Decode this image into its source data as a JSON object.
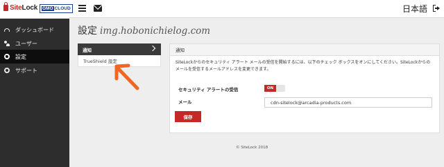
{
  "header": {
    "logo_text_red": "Site",
    "logo_text_dark": "Lock",
    "partner_logo_prefix": "GMO",
    "partner_logo_suffix": "CLOUD",
    "language": "日本語"
  },
  "sidebar": {
    "items": [
      {
        "label": "ダッシュボード",
        "icon": "dashboard-icon"
      },
      {
        "label": "ユーザー",
        "icon": "user-icon"
      },
      {
        "label": "設定",
        "icon": "gear-icon",
        "active": true
      },
      {
        "label": "サポート",
        "icon": "support-icon"
      }
    ]
  },
  "page": {
    "title": "設定",
    "domain": "img.hobonichielog.com"
  },
  "settings_menu": {
    "header": "通知",
    "items": [
      {
        "label": "TrueShield 設定"
      }
    ]
  },
  "notification_panel": {
    "title": "通知",
    "description": "SiteLockからのセキュリティ アラート メールの受信を開始するには、以下のチェック ボックスをオンにしてください。SiteLockからのメールを受信するメールアドレスを変更できます。",
    "alert_label": "セキュリティ アラートの受信",
    "alert_toggle": "ON",
    "email_label": "メール",
    "email_value": "cdn-sitelock@arcadia-products.com",
    "save_label": "保存"
  },
  "footer": {
    "copyright": "© SiteLock 2018"
  },
  "colors": {
    "brand_red": "#c62828",
    "annotation_arrow": "#f26522",
    "sidebar_bg": "#2d2d2d"
  }
}
